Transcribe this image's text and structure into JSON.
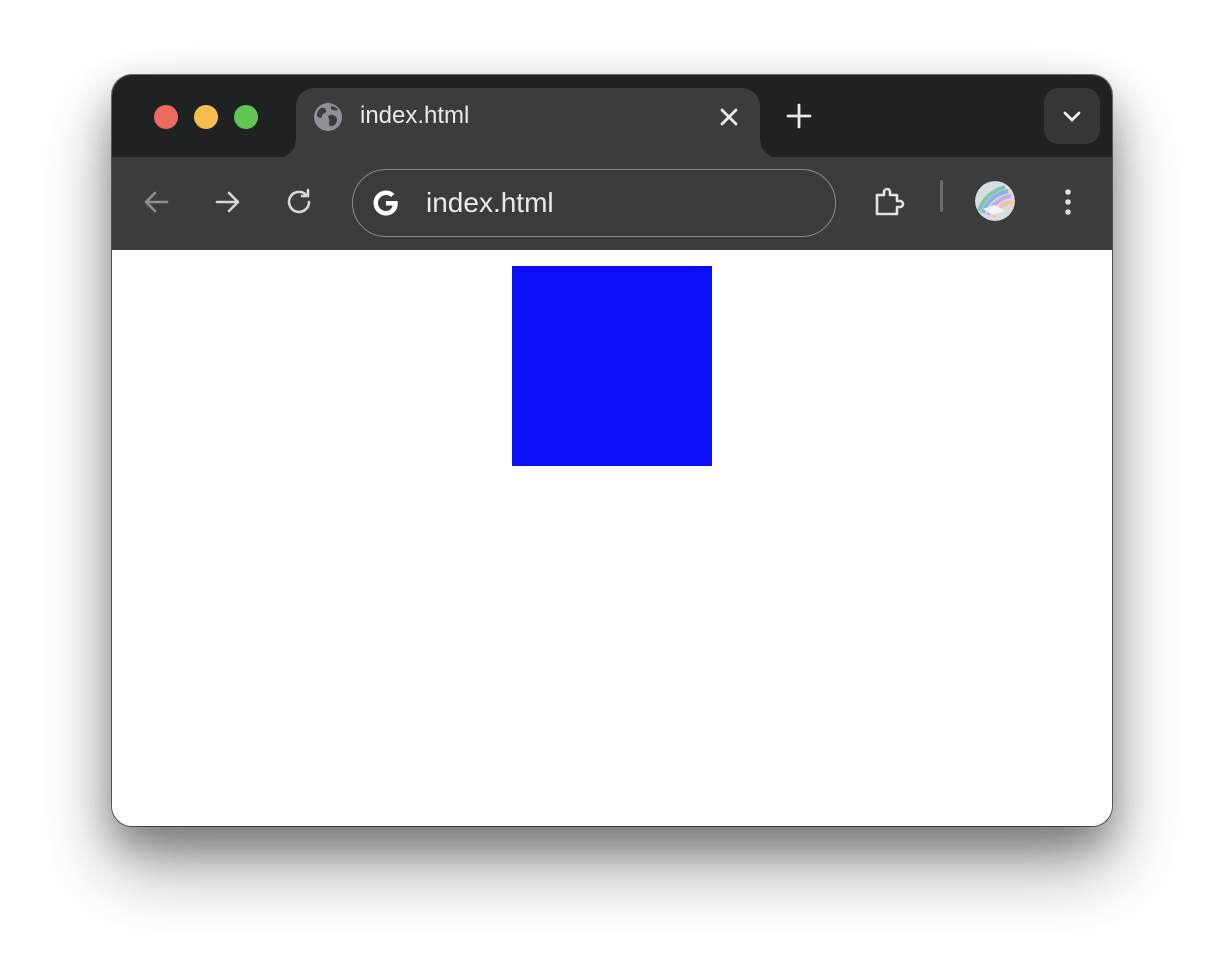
{
  "tab": {
    "title": "index.html",
    "favicon": "globe-icon"
  },
  "omnibox": {
    "url": "index.html",
    "icon": "google-g-icon"
  },
  "page": {
    "box_color": "#0b0ef7"
  },
  "colors": {
    "titlebar": "#202122",
    "toolbar": "#3c3c3c",
    "traffic_close": "#ec6a5e",
    "traffic_minimize": "#f4bf4f",
    "traffic_maximize": "#61c554"
  }
}
